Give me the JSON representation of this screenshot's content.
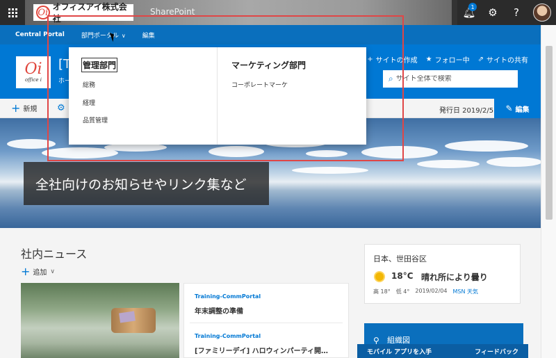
{
  "suite": {
    "company_name": "オフィスアイ株式会社",
    "logo_letter": "Oi",
    "app_name": "SharePoint",
    "notification_count": "1"
  },
  "hub_nav": {
    "items": [
      {
        "label": "Central Portal"
      },
      {
        "label": "部門ポータル"
      },
      {
        "label": "編集"
      }
    ]
  },
  "site": {
    "logo_mark": "Oi",
    "logo_text": "office i",
    "title": "[Tr",
    "home_link": "ホー",
    "actions": [
      {
        "icon": "plus-icon",
        "glyph": "+",
        "label": "サイトの作成"
      },
      {
        "icon": "star-icon",
        "glyph": "★",
        "label": "フォロー中"
      },
      {
        "icon": "share-icon",
        "glyph": "⇗",
        "label": "サイトの共有"
      }
    ],
    "search_placeholder": "サイト全体で検索"
  },
  "command_bar": {
    "new_label": "新規",
    "published_date": "発行日 2019/2/5",
    "edit_label": "編集"
  },
  "mega_menu": {
    "columns": [
      {
        "heading": "管理部門",
        "links": [
          "総務",
          "経理",
          "品質管理"
        ]
      },
      {
        "heading": "マーケティング部門",
        "links": [
          "コーポレートマーケ"
        ]
      }
    ]
  },
  "hero": {
    "caption": "全社向けのお知らせやリンク集など"
  },
  "news": {
    "title": "社内ニュース",
    "add_label": "追加",
    "items": [
      {
        "site": "Training-CommPortal",
        "headline": "年末調整の準備"
      },
      {
        "site": "Training-CommPortal",
        "headline": "[ファミリーデイ] ハロウィンパーティ開…"
      }
    ]
  },
  "weather": {
    "location": "日本、世田谷区",
    "temperature": "18°C",
    "condition": "晴れ所により曇り",
    "high": "高 18°",
    "low": "低 4°",
    "date": "2019/02/04",
    "source": "MSN 天気"
  },
  "org_chart": {
    "label": "組織図"
  },
  "footer": {
    "mobile_app": "モバイル アプリを入手",
    "feedback": "フィードバック"
  },
  "colors": {
    "accent": "#0078d4",
    "highlight": "#e04646"
  }
}
